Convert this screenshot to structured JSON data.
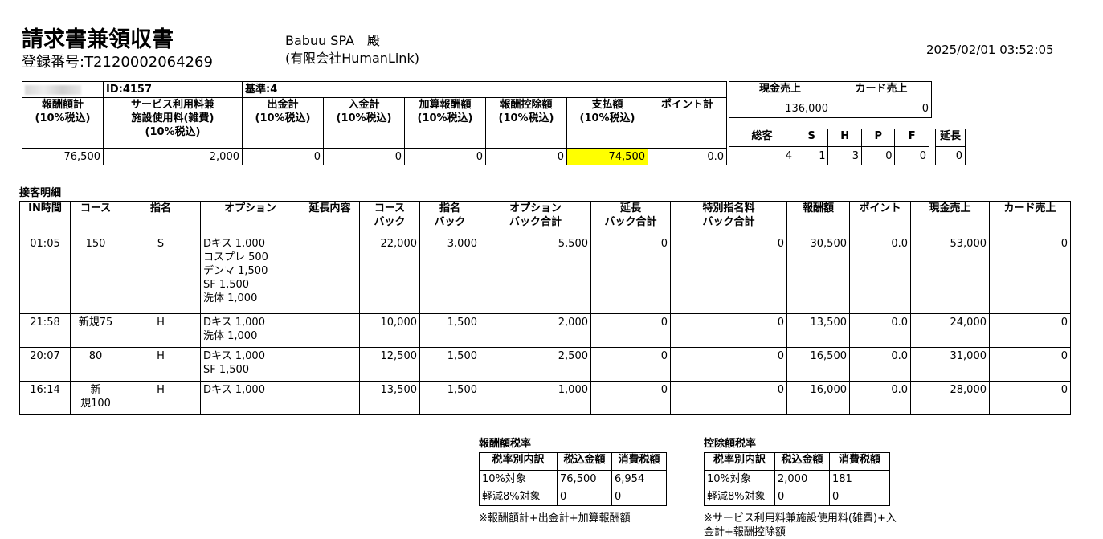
{
  "header": {
    "title": "請求書兼領収書",
    "registration": "登録番号:T2120002064269",
    "recipient_name": "Babuu SPA　殿",
    "recipient_company": "(有限会社HumanLink)",
    "datetime": "2025/02/01 03:52:05"
  },
  "summary": {
    "id_label": "ID:4157",
    "base_label": "基準:4",
    "headers": [
      "報酬額計\n(10%税込)",
      "サービス利用料兼\n施設使用料(雑費)\n(10%税込)",
      "出金計\n(10%税込)",
      "入金計\n(10%税込)",
      "加算報酬額\n(10%税込)",
      "報酬控除額\n(10%税込)",
      "支払額\n(10%税込)",
      "ポイント計"
    ],
    "values": [
      "76,500",
      "2,000",
      "0",
      "0",
      "0",
      "0",
      "74,500",
      "0.0"
    ]
  },
  "sales": {
    "headers": [
      "現金売上",
      "カード売上"
    ],
    "values": [
      "136,000",
      "0"
    ]
  },
  "counts": {
    "headers": [
      "総客",
      "S",
      "H",
      "P",
      "F"
    ],
    "values": [
      "4",
      "1",
      "3",
      "0",
      "0"
    ],
    "ext_header": "延長",
    "ext_value": "0"
  },
  "detail": {
    "section_title": "接客明細",
    "headers": [
      "IN時間",
      "コース",
      "指名",
      "オプション",
      "延長内容",
      "コース\nバック",
      "指名\nバック",
      "オプション\nバック合計",
      "延長\nバック合計",
      "特別指名料\nバック合計",
      "報酬額",
      "ポイント",
      "現金売上",
      "カード売上"
    ],
    "rows": [
      {
        "in_time": "01:05",
        "course": "150",
        "nomination": "S",
        "options": "Dキス 1,000\nコスプレ 500\nデンマ 1,500\nSF 1,500\n洗体 1,000",
        "extension": "",
        "course_back": "22,000",
        "nom_back": "3,000",
        "opt_back": "5,500",
        "ext_back": "0",
        "special_back": "0",
        "reward": "30,500",
        "point": "0.0",
        "cash": "53,000",
        "card": "0"
      },
      {
        "in_time": "21:58",
        "course": "新規75",
        "nomination": "H",
        "options": "Dキス 1,000\n洗体 1,000",
        "extension": "",
        "course_back": "10,000",
        "nom_back": "1,500",
        "opt_back": "2,000",
        "ext_back": "0",
        "special_back": "0",
        "reward": "13,500",
        "point": "0.0",
        "cash": "24,000",
        "card": "0"
      },
      {
        "in_time": "20:07",
        "course": "80",
        "nomination": "H",
        "options": "Dキス 1,000\nSF 1,500",
        "extension": "",
        "course_back": "12,500",
        "nom_back": "1,500",
        "opt_back": "2,500",
        "ext_back": "0",
        "special_back": "0",
        "reward": "16,500",
        "point": "0.0",
        "cash": "31,000",
        "card": "0"
      },
      {
        "in_time": "16:14",
        "course": "新\n規100",
        "nomination": "H",
        "options": "Dキス 1,000",
        "extension": "",
        "course_back": "13,500",
        "nom_back": "1,500",
        "opt_back": "1,000",
        "ext_back": "0",
        "special_back": "0",
        "reward": "16,000",
        "point": "0.0",
        "cash": "28,000",
        "card": "0"
      }
    ]
  },
  "tax_reward": {
    "title": "報酬額税率",
    "headers": [
      "税率別内訳",
      "税込金額",
      "消費税額"
    ],
    "rows": [
      [
        "10%対象",
        "76,500",
        "6,954"
      ],
      [
        "軽減8%対象",
        "0",
        "0"
      ]
    ],
    "note": "※報酬額計+出金計+加算報酬額"
  },
  "tax_deduction": {
    "title": "控除額税率",
    "headers": [
      "税率別内訳",
      "税込金額",
      "消費税額"
    ],
    "rows": [
      [
        "10%対象",
        "2,000",
        "181"
      ],
      [
        "軽減8%対象",
        "0",
        "0"
      ]
    ],
    "note": "※サービス利用料兼施設使用料(雑費)+入\n金計+報酬控除額"
  }
}
